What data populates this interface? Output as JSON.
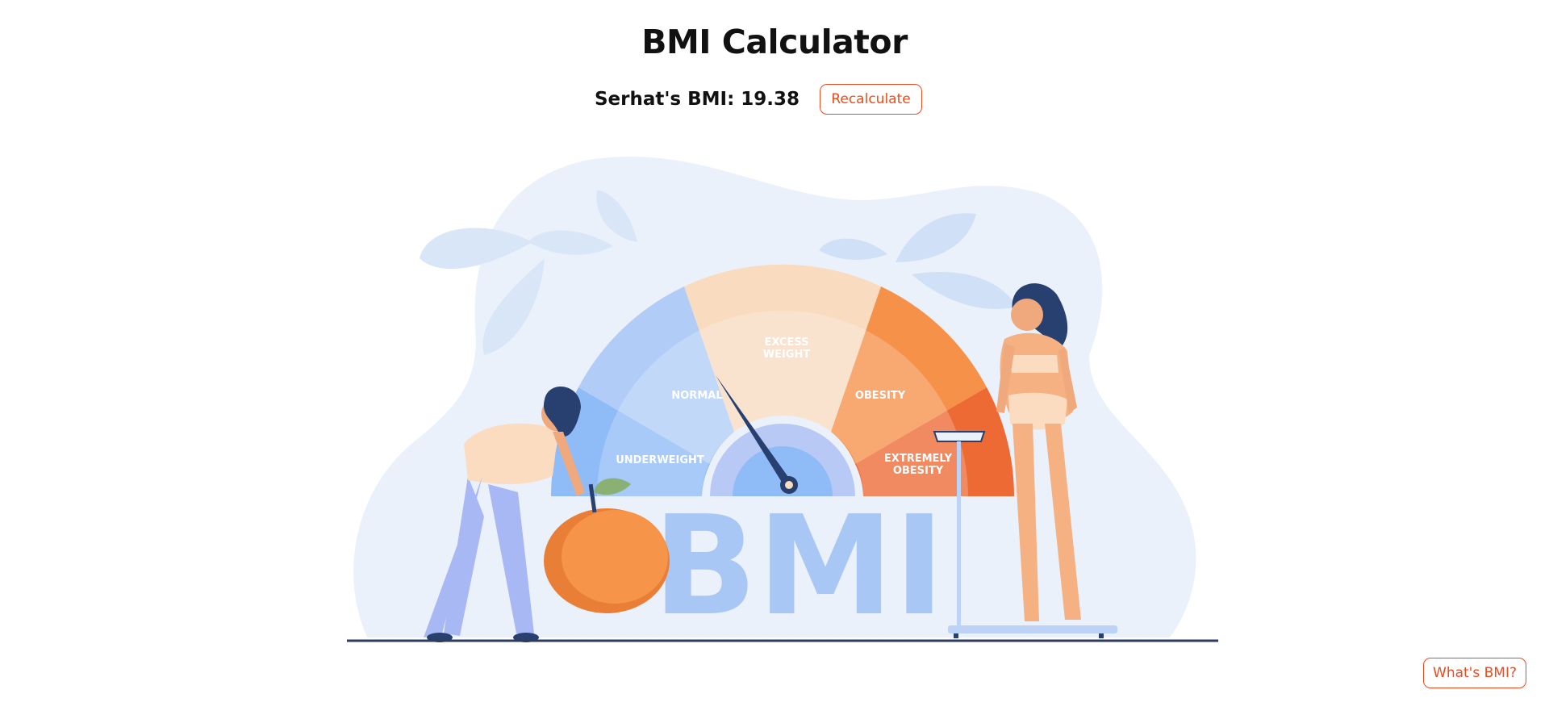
{
  "header": {
    "title": "BMI Calculator"
  },
  "result": {
    "text": "Serhat's BMI: 19.38",
    "recalculate_label": "Recalculate"
  },
  "gauge": {
    "labels": {
      "underweight": "UNDERWEIGHT",
      "normal": "NORMAL",
      "excess_line1": "EXCESS",
      "excess_line2": "WEIGHT",
      "obesity": "OBESITY",
      "extreme_line1": "EXTREMELY",
      "extreme_line2": "OBESITY"
    },
    "big_text": "BMI"
  },
  "footer": {
    "whats_bmi_label": "What's BMI?"
  },
  "colors": {
    "accent": "#ee4a1b",
    "underweight": "#8fbcf7",
    "normal": "#b1cdf7",
    "excess": "#f9dcc0",
    "obesity": "#f6914a",
    "extreme": "#ee6a34",
    "backdrop": "#e9f1fa"
  }
}
